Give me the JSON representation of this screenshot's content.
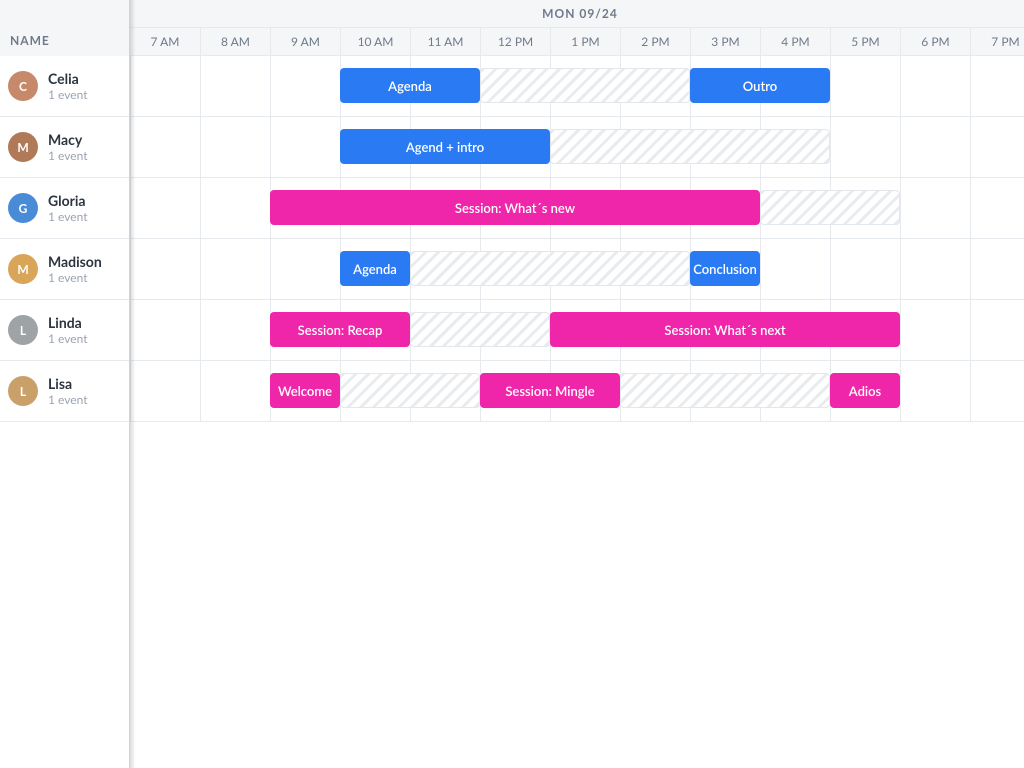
{
  "header": {
    "name_col": "NAME",
    "date": "MON 09/24",
    "hours": [
      "7 AM",
      "8 AM",
      "9 AM",
      "10 AM",
      "11 AM",
      "12 PM",
      "1 PM",
      "2 PM",
      "3 PM",
      "4 PM",
      "5 PM",
      "6 PM",
      "7 PM"
    ]
  },
  "timeline": {
    "startHour": 7,
    "colWidthPx": 70,
    "rowHeightPx": 61
  },
  "colors": {
    "blue": "#2a7bf3",
    "pink": "#ef26a9",
    "avatars": [
      "#c68a6b",
      "#b07a58",
      "#4a8bd8",
      "#d9a559",
      "#9ea3a6",
      "#caa06a"
    ]
  },
  "people": [
    {
      "name": "Celia",
      "sub": "1 event",
      "initial": "C"
    },
    {
      "name": "Macy",
      "sub": "1 event",
      "initial": "M"
    },
    {
      "name": "Gloria",
      "sub": "1 event",
      "initial": "G"
    },
    {
      "name": "Madison",
      "sub": "1 event",
      "initial": "M"
    },
    {
      "name": "Linda",
      "sub": "1 event",
      "initial": "L"
    },
    {
      "name": "Lisa",
      "sub": "1 event",
      "initial": "L"
    }
  ],
  "events": [
    {
      "row": 0,
      "label": "Agenda",
      "kind": "blue",
      "start": 10,
      "end": 12
    },
    {
      "row": 0,
      "label": "",
      "kind": "ghost",
      "start": 12,
      "end": 15
    },
    {
      "row": 0,
      "label": "Outro",
      "kind": "blue",
      "start": 15,
      "end": 17
    },
    {
      "row": 1,
      "label": "Agend + intro",
      "kind": "blue",
      "start": 10,
      "end": 13
    },
    {
      "row": 1,
      "label": "",
      "kind": "ghost",
      "start": 13,
      "end": 17
    },
    {
      "row": 2,
      "label": "Session: What´s new",
      "kind": "pink",
      "start": 9,
      "end": 16
    },
    {
      "row": 2,
      "label": "",
      "kind": "ghost",
      "start": 16,
      "end": 18
    },
    {
      "row": 3,
      "label": "Agenda",
      "kind": "blue",
      "start": 10,
      "end": 11
    },
    {
      "row": 3,
      "label": "",
      "kind": "ghost",
      "start": 11,
      "end": 15
    },
    {
      "row": 3,
      "label": "Conclusion",
      "kind": "blue",
      "start": 15,
      "end": 16
    },
    {
      "row": 4,
      "label": "Session: Recap",
      "kind": "pink",
      "start": 9,
      "end": 11
    },
    {
      "row": 4,
      "label": "",
      "kind": "ghost",
      "start": 11,
      "end": 13
    },
    {
      "row": 4,
      "label": "Session: What´s next",
      "kind": "pink",
      "start": 13,
      "end": 18
    },
    {
      "row": 5,
      "label": "Welcome",
      "kind": "pink",
      "start": 9,
      "end": 10
    },
    {
      "row": 5,
      "label": "",
      "kind": "ghost",
      "start": 10,
      "end": 12
    },
    {
      "row": 5,
      "label": "Session: Mingle",
      "kind": "pink",
      "start": 12,
      "end": 14
    },
    {
      "row": 5,
      "label": "",
      "kind": "ghost",
      "start": 14,
      "end": 17
    },
    {
      "row": 5,
      "label": "Adios",
      "kind": "pink",
      "start": 17,
      "end": 18
    }
  ]
}
